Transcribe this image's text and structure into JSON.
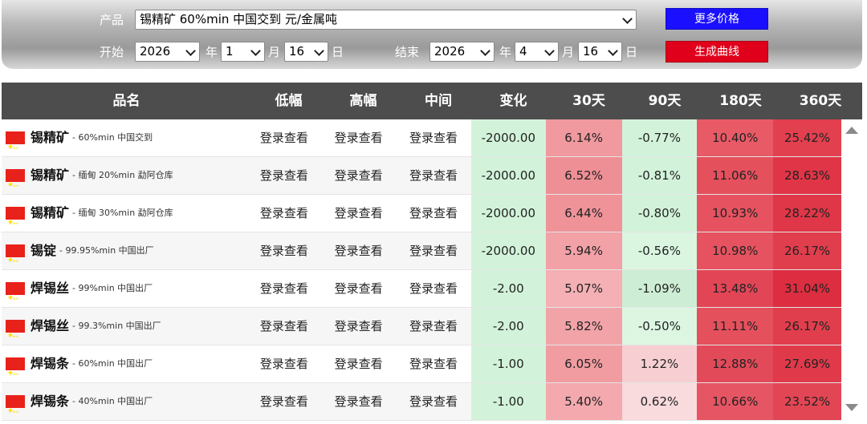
{
  "filters": {
    "product_label": "产品",
    "product_value": "锡精矿 60%min 中国交到 元/金属吨",
    "start_label": "开始",
    "end_label": "结束",
    "start": {
      "year": "2026",
      "month": "1",
      "day": "16"
    },
    "end": {
      "year": "2026",
      "month": "4",
      "day": "16"
    },
    "year_unit": "年",
    "month_unit": "月",
    "day_unit": "日",
    "more_prices_button": "更多价格",
    "generate_curve_button": "生成曲线",
    "colors": {
      "more_prices": "#1a10ff",
      "generate_curve": "#e0001b"
    }
  },
  "table": {
    "headers": {
      "name": "品名",
      "low": "低幅",
      "high": "高幅",
      "mid": "中间",
      "change": "变化",
      "d30": "30天",
      "d90": "90天",
      "d180": "180天",
      "d360": "360天"
    },
    "login_text": "登录查看",
    "rows": [
      {
        "name": "锡精矿",
        "spec": "60%min 中国交到",
        "change": "-2000.00",
        "d30": "6.14%",
        "d90": "-0.77%",
        "d180": "10.40%",
        "d360": "25.42%",
        "c30": "#f0999e",
        "c90": "#d2f3da",
        "c180": "#e85a66",
        "c360": "#e2404f"
      },
      {
        "name": "锡精矿",
        "spec": "缅甸 20%min 勐阿仓库",
        "change": "-2000.00",
        "d30": "6.52%",
        "d90": "-0.81%",
        "d180": "11.06%",
        "d360": "28.63%",
        "c30": "#ee8f95",
        "c90": "#d2f3da",
        "c180": "#e5505d",
        "c360": "#df3546"
      },
      {
        "name": "锡精矿",
        "spec": "缅甸 30%min 勐阿仓库",
        "change": "-2000.00",
        "d30": "6.44%",
        "d90": "-0.80%",
        "d180": "10.93%",
        "d360": "28.22%",
        "c30": "#ef9399",
        "c90": "#d2f3da",
        "c180": "#e65260",
        "c360": "#df3748"
      },
      {
        "name": "锡锭",
        "spec": "99.95%min 中国出厂",
        "change": "-2000.00",
        "d30": "5.94%",
        "d90": "-0.56%",
        "d180": "10.98%",
        "d360": "26.17%",
        "c30": "#f2a1a6",
        "c90": "#daf5e0",
        "c180": "#e65260",
        "c360": "#e13e4d"
      },
      {
        "name": "焊锡丝",
        "spec": "99%min 中国出厂",
        "change": "-2.00",
        "d30": "5.07%",
        "d90": "-1.09%",
        "d180": "13.48%",
        "d360": "31.04%",
        "c30": "#f4b0b4",
        "c90": "#cdeed5",
        "c180": "#e24656",
        "c360": "#dc2e40"
      },
      {
        "name": "焊锡丝",
        "spec": "99.3%min 中国出厂",
        "change": "-2.00",
        "d30": "5.82%",
        "d90": "-0.50%",
        "d180": "11.11%",
        "d360": "26.17%",
        "c30": "#f2a3a8",
        "c90": "#dcf6e2",
        "c180": "#e5505d",
        "c360": "#e13e4d"
      },
      {
        "name": "焊锡条",
        "spec": "60%min 中国出厂",
        "change": "-1.00",
        "d30": "6.05%",
        "d90": "1.22%",
        "d180": "12.88%",
        "d360": "27.69%",
        "c30": "#f09ca1",
        "c90": "#f7cfd2",
        "c180": "#e34a59",
        "c360": "#e03a4a"
      },
      {
        "name": "焊锡条",
        "spec": "40%min 中国出厂",
        "change": "-1.00",
        "d30": "5.40%",
        "d90": "0.62%",
        "d180": "10.66%",
        "d360": "23.52%",
        "c30": "#f3a9ad",
        "c90": "#f9dadd",
        "c180": "#e65563",
        "c360": "#e24654"
      }
    ]
  }
}
